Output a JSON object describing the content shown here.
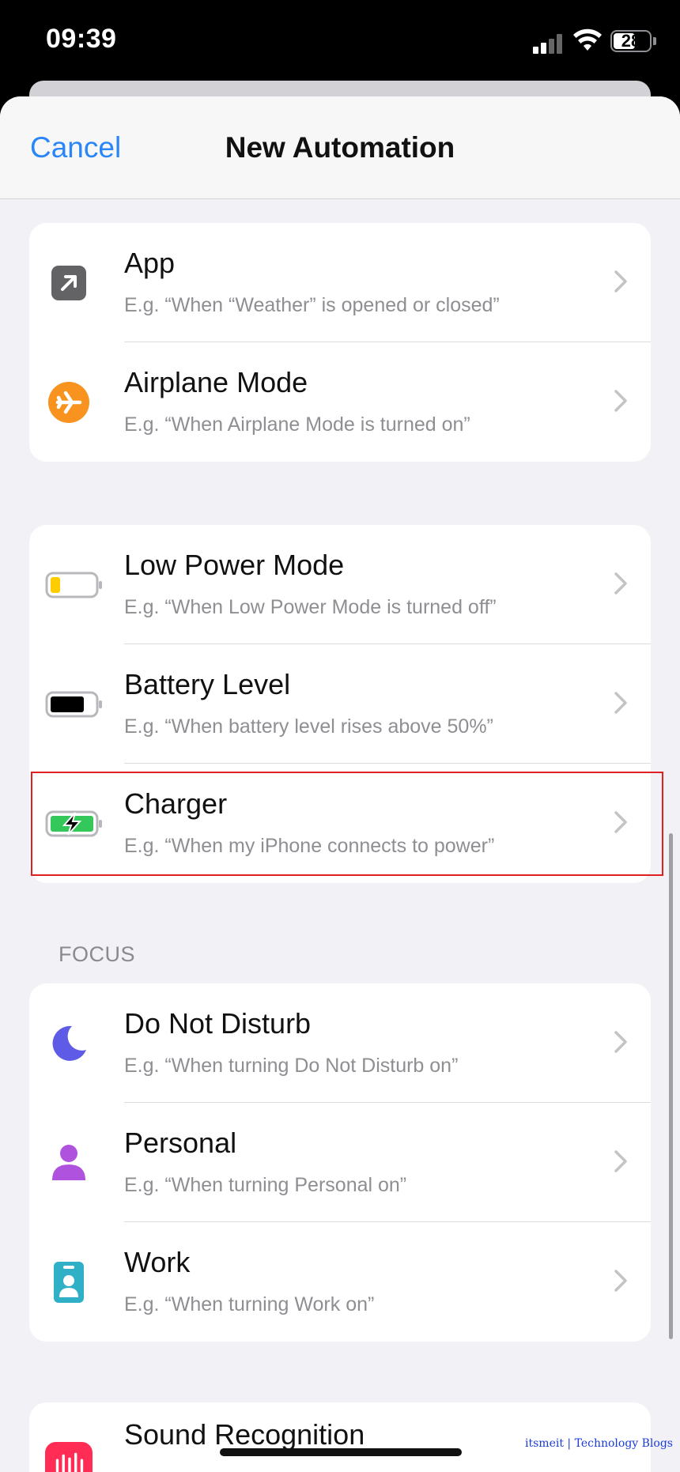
{
  "status_bar": {
    "time": "09:39",
    "battery": "28"
  },
  "nav": {
    "cancel_label": "Cancel",
    "title": "New Automation"
  },
  "groups": [
    {
      "items": [
        {
          "title": "App",
          "subtitle": "E.g. “When “Weather” is opened or closed”",
          "icon": "app-arrow-icon"
        },
        {
          "title": "Airplane Mode",
          "subtitle": "E.g. “When Airplane Mode is turned on”",
          "icon": "airplane-icon"
        }
      ]
    },
    {
      "items": [
        {
          "title": "Low Power Mode",
          "subtitle": "E.g. “When Low Power Mode is turned off”",
          "icon": "low-battery-icon"
        },
        {
          "title": "Battery Level",
          "subtitle": "E.g. “When battery level rises above 50%”",
          "icon": "battery-icon"
        },
        {
          "title": "Charger",
          "subtitle": "E.g. “When my iPhone connects to power”",
          "icon": "charging-battery-icon"
        }
      ]
    },
    {
      "header": "FOCUS",
      "items": [
        {
          "title": "Do Not Disturb",
          "subtitle": "E.g. “When turning Do Not Disturb on”",
          "icon": "moon-icon"
        },
        {
          "title": "Personal",
          "subtitle": "E.g. “When turning Personal on”",
          "icon": "person-icon"
        },
        {
          "title": "Work",
          "subtitle": "E.g. “When turning Work on”",
          "icon": "badge-icon"
        }
      ]
    },
    {
      "items": [
        {
          "title": "Sound Recognition",
          "icon": "sound-wave-icon"
        }
      ]
    }
  ],
  "watermark": "itsmeit | Technology Blogs",
  "colors": {
    "accent": "#2a86f7",
    "highlight": "#e02020",
    "airplane": "#f7931e",
    "low_battery": "#ffcc00",
    "charging": "#34c759",
    "moon": "#5e5ce6",
    "person": "#af52de",
    "work": "#30b0c7",
    "sound": "#ff2d55"
  }
}
